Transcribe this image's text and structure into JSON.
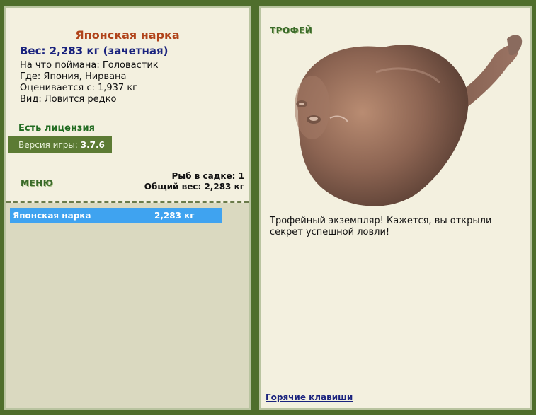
{
  "fish": {
    "title": "Японская нарка",
    "weight_line": "Вес: 2,283 кг (зачетная)",
    "caught_on": "На что поймана: Головастик",
    "location": "Где: Япония, Нирвана",
    "rated_from": "Оценивается с: 1,937 кг",
    "kind": "Вид: Ловится редко"
  },
  "license": "Есть лицензия",
  "version": {
    "label": "Версия игры:",
    "value": "3.7.6"
  },
  "menu_label": "МЕНЮ",
  "keepnet": {
    "count_line": "Рыб в садке: 1",
    "total_line": "Общий вес: 2,283 кг"
  },
  "catch_list": [
    {
      "name": "Японская нарка",
      "weight": "2,283 кг"
    }
  ],
  "trophy": {
    "title": "ТРОФЕЙ",
    "text": "Трофейный экземпляр! Кажется, вы открыли секрет успешной ловли!"
  },
  "hotkeys_label": "Горячие клавиши",
  "colors": {
    "background": "#4f6e2c",
    "panel": "#f3f0df",
    "title": "#b0431a",
    "weight": "#1a237e",
    "selection": "#3fa3f0"
  }
}
